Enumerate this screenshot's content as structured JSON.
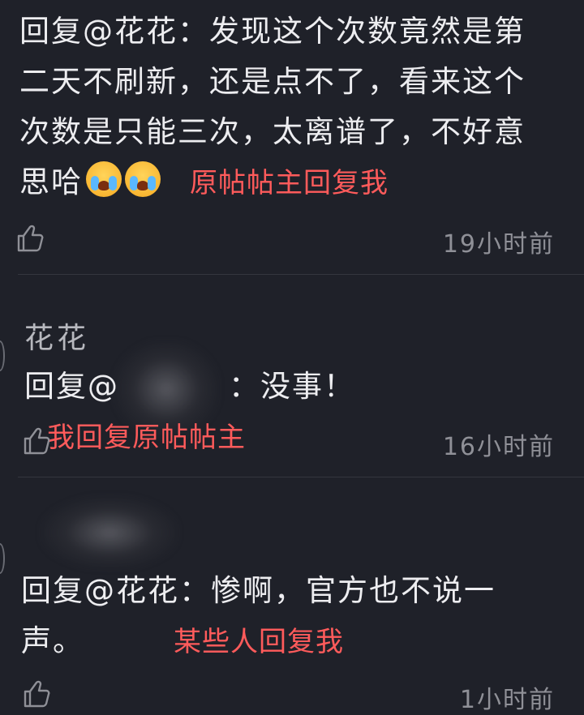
{
  "comments": [
    {
      "text_lines": [
        "回复@花花：发现这个次数竟然是第",
        "二天不刷新，还是点不了，看来这个",
        "次数是只能三次，太离谱了，不好意"
      ],
      "last_line_text": "思哈",
      "emojis": [
        "crying-face",
        "crying-face"
      ],
      "annotation": "原帖帖主回复我",
      "time": "19小时前"
    },
    {
      "author": "花花",
      "reply_prefix": "回复@",
      "reply_suffix": "：没事！",
      "annotation": "我回复原帖帖主",
      "time": "16小时前"
    },
    {
      "line1": "回复@花花：惨啊，官方也不说一",
      "line2": "声。",
      "annotation": "某些人回复我",
      "time": "1小时前"
    }
  ],
  "colors": {
    "background": "#1f2129",
    "annotation_red": "#ff5b5b",
    "muted": "#8f9097"
  },
  "icons": {
    "like": "thumbs-up-icon"
  }
}
